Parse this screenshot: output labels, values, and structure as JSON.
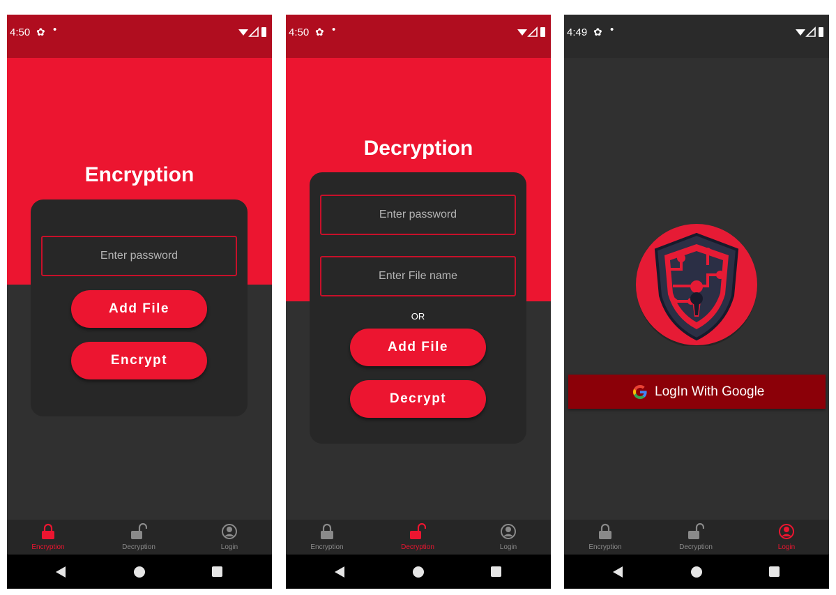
{
  "colors": {
    "accent": "#ec1530",
    "status_red": "#b00d1f",
    "dark_bg": "#303030",
    "card": "#272727",
    "google_btn": "#8b0008"
  },
  "screens": [
    {
      "status": {
        "time": "4:50",
        "icons": [
          "gear-icon",
          "dot-icon",
          "wifi-icon",
          "signal-icon",
          "battery-icon"
        ]
      },
      "title": "Encryption",
      "fields": [
        "Enter password"
      ],
      "buttons": [
        "Add File",
        "Encrypt"
      ],
      "nav": {
        "active": "Encryption",
        "items": [
          "Encryption",
          "Decryption",
          "Login"
        ]
      }
    },
    {
      "status": {
        "time": "4:50",
        "icons": [
          "gear-icon",
          "dot-icon",
          "wifi-icon",
          "signal-icon",
          "battery-icon"
        ]
      },
      "title": "Decryption",
      "fields": [
        "Enter password",
        "Enter File name"
      ],
      "or_label": "OR",
      "buttons": [
        "Add File",
        "Decrypt"
      ],
      "nav": {
        "active": "Decryption",
        "items": [
          "Encryption",
          "Decryption",
          "Login"
        ]
      }
    },
    {
      "status": {
        "time": "4:49",
        "icons": [
          "gear-icon",
          "dot-icon",
          "wifi-icon",
          "signal-icon",
          "battery-icon"
        ]
      },
      "logo_icon": "shield-keyhole-logo",
      "google_button": {
        "label": "LogIn With Google",
        "icon": "google-g-icon"
      },
      "nav": {
        "active": "Login",
        "items": [
          "Encryption",
          "Decryption",
          "Login"
        ]
      }
    }
  ]
}
